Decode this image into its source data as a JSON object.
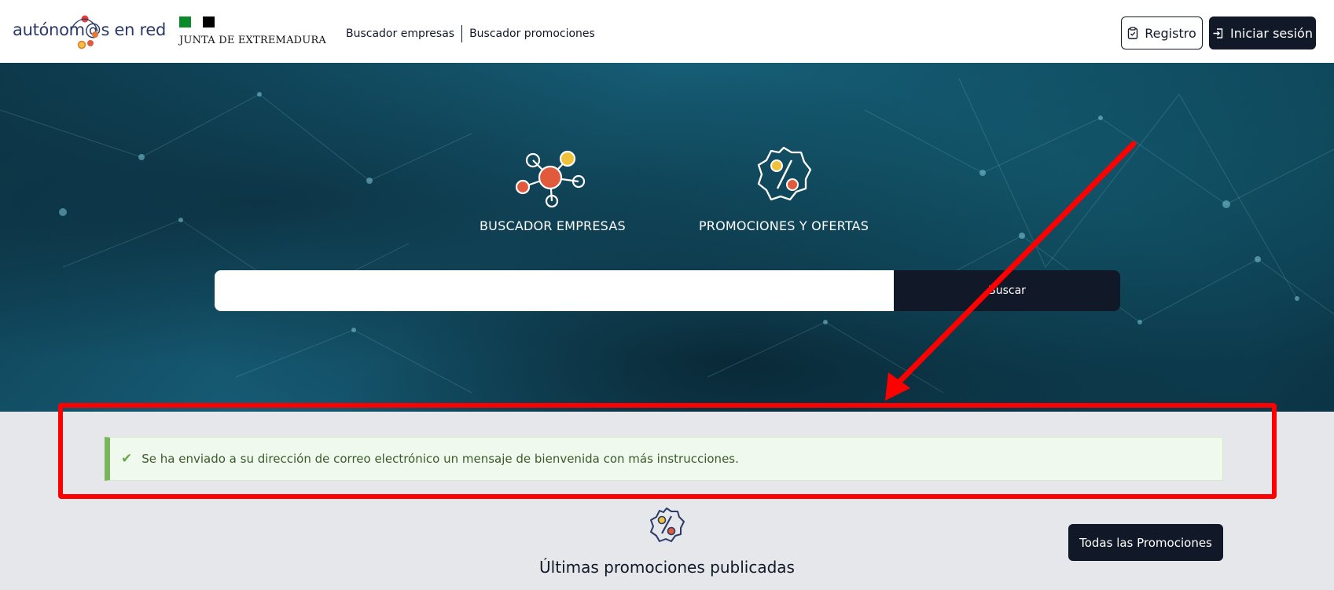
{
  "header": {
    "logo_text": "autónom@s en red",
    "junta_text": "JUNTA DE EXTREMADURA",
    "nav": [
      {
        "label": "Buscador empresas"
      },
      {
        "label": "Buscador promociones"
      }
    ],
    "register_label": "Registro",
    "login_label": "Iniciar sesión"
  },
  "hero": {
    "items": [
      {
        "label": "BUSCADOR EMPRESAS",
        "icon": "network-icon"
      },
      {
        "label": "PROMOCIONES Y OFERTAS",
        "icon": "percent-badge-icon"
      }
    ],
    "search": {
      "value": "",
      "placeholder": "",
      "button_label": "Buscar"
    }
  },
  "alert": {
    "icon": "check-icon",
    "message": "Se ha enviado a su dirección de correo electrónico un mensaje de bienvenida con más instrucciones.",
    "color": "#7ab55c"
  },
  "section": {
    "title": "Últimas promociones publicadas",
    "all_button_label": "Todas las Promociones"
  },
  "annotation": {
    "color": "#ff0000"
  },
  "colors": {
    "dark": "#111827",
    "accent_orange": "#e05a3b",
    "accent_yellow": "#f0c23a"
  }
}
